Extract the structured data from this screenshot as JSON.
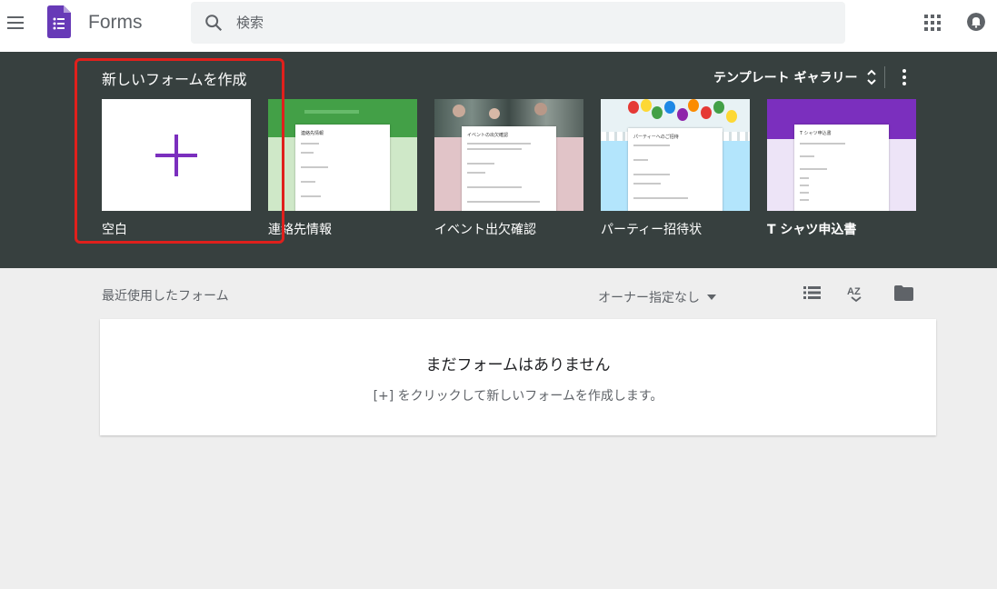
{
  "header": {
    "app_name": "Forms",
    "search_placeholder": "検索"
  },
  "templates_panel": {
    "title": "新しいフォームを作成",
    "gallery_label": "テンプレート ギャラリー",
    "items": [
      {
        "label": "空白",
        "thumb_title": ""
      },
      {
        "label": "連絡先情報",
        "thumb_title": "連絡先情報",
        "accent": "#43a047"
      },
      {
        "label": "イベント出欠確認",
        "thumb_title": "イベントの出欠確認",
        "accent": "#e1c4c8"
      },
      {
        "label": "パーティー招待状",
        "thumb_title": "パーティーへのご招待",
        "accent": "#b3e5fc"
      },
      {
        "label": "T シャツ申込書",
        "thumb_title": "T シャツ申込書",
        "accent": "#7b2fbe"
      }
    ]
  },
  "recent": {
    "title": "最近使用したフォーム",
    "owner_filter": "オーナー指定なし"
  },
  "empty_state": {
    "title": "まだフォームはありません",
    "subtitle": "[+] をクリックして新しいフォームを作成します。"
  },
  "colors": {
    "panel_bg": "#37403f",
    "forms_purple": "#673ab7",
    "plus_purple": "#7b2fbe",
    "highlight_red": "#e0201c"
  },
  "icons": [
    "menu-icon",
    "forms-logo-icon",
    "search-icon",
    "apps-grid-icon",
    "account-icon",
    "unfold-icon",
    "more-vert-icon",
    "plus-icon",
    "caret-down-icon",
    "list-view-icon",
    "sort-az-icon",
    "folder-icon"
  ]
}
